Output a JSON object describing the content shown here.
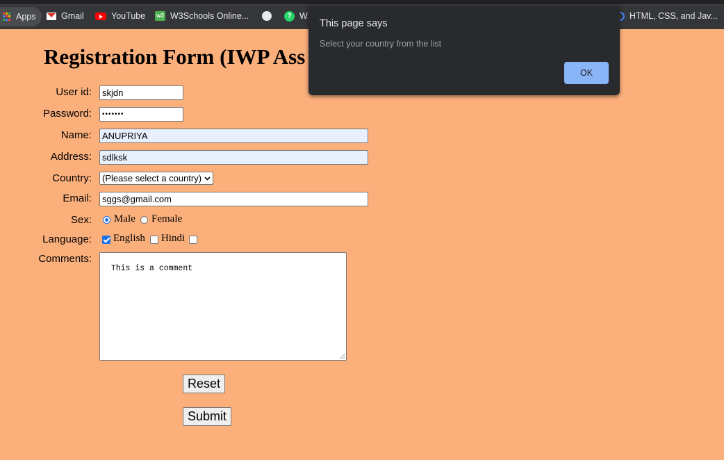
{
  "bookmarks": {
    "apps": "Apps",
    "items": [
      {
        "label": "Gmail",
        "icon": "gmail-icon"
      },
      {
        "label": "YouTube",
        "icon": "youtube-icon"
      },
      {
        "label": "W3Schools Online...",
        "icon": "w3schools-icon"
      },
      {
        "label": "",
        "icon": "globe-icon"
      },
      {
        "label": "W",
        "icon": "whatsapp-icon"
      },
      {
        "label": "HTML, CSS, and Jav...",
        "icon": "bookmark-icon"
      }
    ]
  },
  "form": {
    "title": "Registration Form (IWP Ass",
    "labels": {
      "userid": "User id:",
      "password": "Password:",
      "name": "Name:",
      "address": "Address:",
      "country": "Country:",
      "email": "Email:",
      "sex": "Sex:",
      "language": "Language:",
      "comments": "Comments:"
    },
    "values": {
      "userid": "skjdn",
      "password": "•••••••",
      "name": "ANUPRIYA",
      "address": "sdlksk",
      "country": "(Please select a country)",
      "email": "sggs@gmail.com",
      "comments": "This is a comment"
    },
    "sex_options": {
      "male": "Male",
      "female": "Female",
      "selected": "Male"
    },
    "language_options": {
      "english": "English",
      "hindi": "Hindi",
      "english_checked": true,
      "hindi_checked": false,
      "third_checked": false
    },
    "buttons": {
      "reset": "Reset",
      "submit": "Submit"
    }
  },
  "dialog": {
    "title": "This page says",
    "message": "Select your country from the list",
    "ok": "OK",
    "ok_color": "#8ab4f8"
  }
}
